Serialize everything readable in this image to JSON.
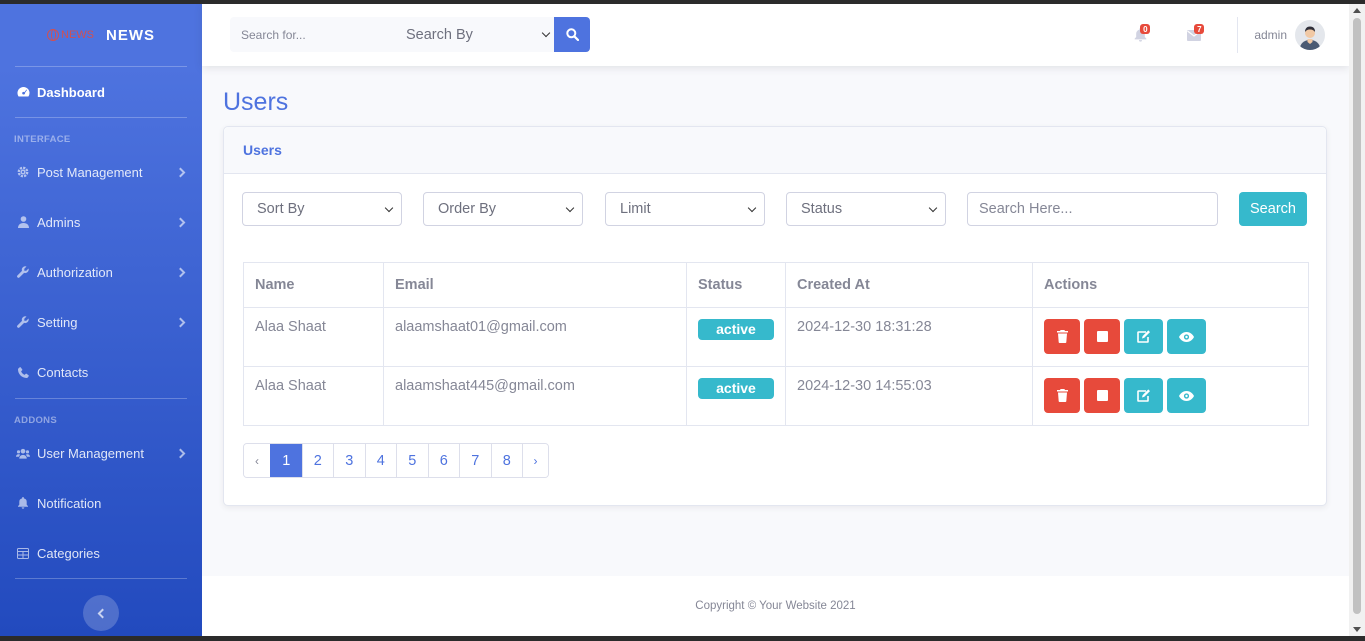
{
  "brand": {
    "logo_text": "NEWS",
    "name": "NEWS"
  },
  "sidebar": {
    "dashboard": "Dashboard",
    "heading_interface": "INTERFACE",
    "interface_items": [
      "Post Management",
      "Admins",
      "Authorization",
      "Setting",
      "Contacts"
    ],
    "heading_addons": "ADDONS",
    "addon_items": [
      "User Management",
      "Notification",
      "Categories"
    ]
  },
  "topbar": {
    "search_placeholder": "Search for...",
    "search_by": "Search By",
    "notification_count": "0",
    "message_count": "7",
    "user_name": "admin"
  },
  "page": {
    "title": "Users"
  },
  "card": {
    "header": "Users",
    "filters": {
      "sort_by": "Sort By",
      "order_by": "Order By",
      "limit": "Limit",
      "status": "Status",
      "search_placeholder": "Search Here...",
      "search_button": "Search"
    },
    "table": {
      "columns": [
        "Name",
        "Email",
        "Status",
        "Created At",
        "Actions"
      ],
      "rows": [
        {
          "name": "Alaa Shaat",
          "email": "alaamshaat01@gmail.com",
          "status": "active",
          "created_at": "2024-12-30 18:31:28"
        },
        {
          "name": "Alaa Shaat",
          "email": "alaamshaat445@gmail.com",
          "status": "active",
          "created_at": "2024-12-30 14:55:03"
        }
      ]
    },
    "pagination": {
      "prev": "‹",
      "pages": [
        "1",
        "2",
        "3",
        "4",
        "5",
        "6",
        "7",
        "8"
      ],
      "active": "1",
      "next": "›"
    }
  },
  "footer": {
    "copyright": "Copyright © Your Website 2021"
  },
  "colors": {
    "primary": "#4e73df",
    "info": "#36b9cc",
    "danger": "#e74a3b",
    "text_muted": "#858796"
  }
}
